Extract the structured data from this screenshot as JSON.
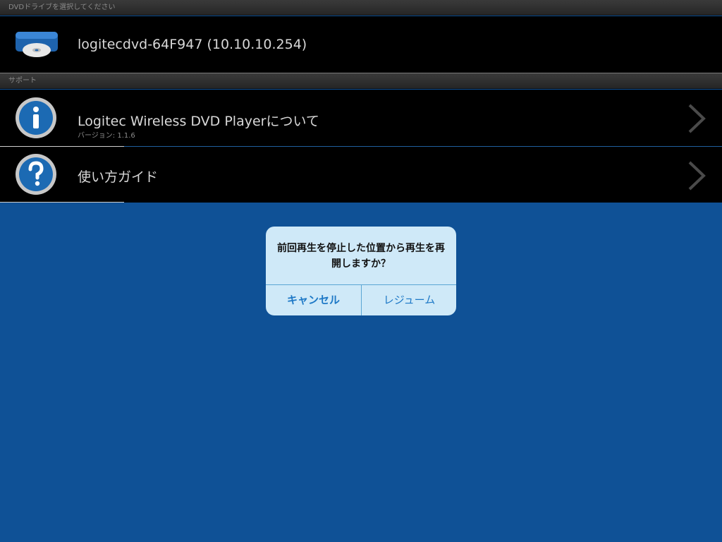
{
  "sections": {
    "drive_header": "DVDドライブを選択してください",
    "support_header": "サポート"
  },
  "drive": {
    "name": "logitecdvd-64F947 (10.10.10.254)",
    "icon": "dvd-drive-icon"
  },
  "support": {
    "about_title": "Logitec Wireless DVD Playerについて",
    "version": "バージョン: 1.1.6",
    "guide_title": "使い方ガイド",
    "about_icon": "info-icon",
    "guide_icon": "help-icon"
  },
  "alert": {
    "message": "前回再生を停止した位置から再生を再開しますか？",
    "cancel_label": "キャンセル",
    "resume_label": "レジューム"
  },
  "colors": {
    "background": "#0f5196",
    "alert_bg": "#cfe9f8",
    "accent": "#1d78c6"
  }
}
